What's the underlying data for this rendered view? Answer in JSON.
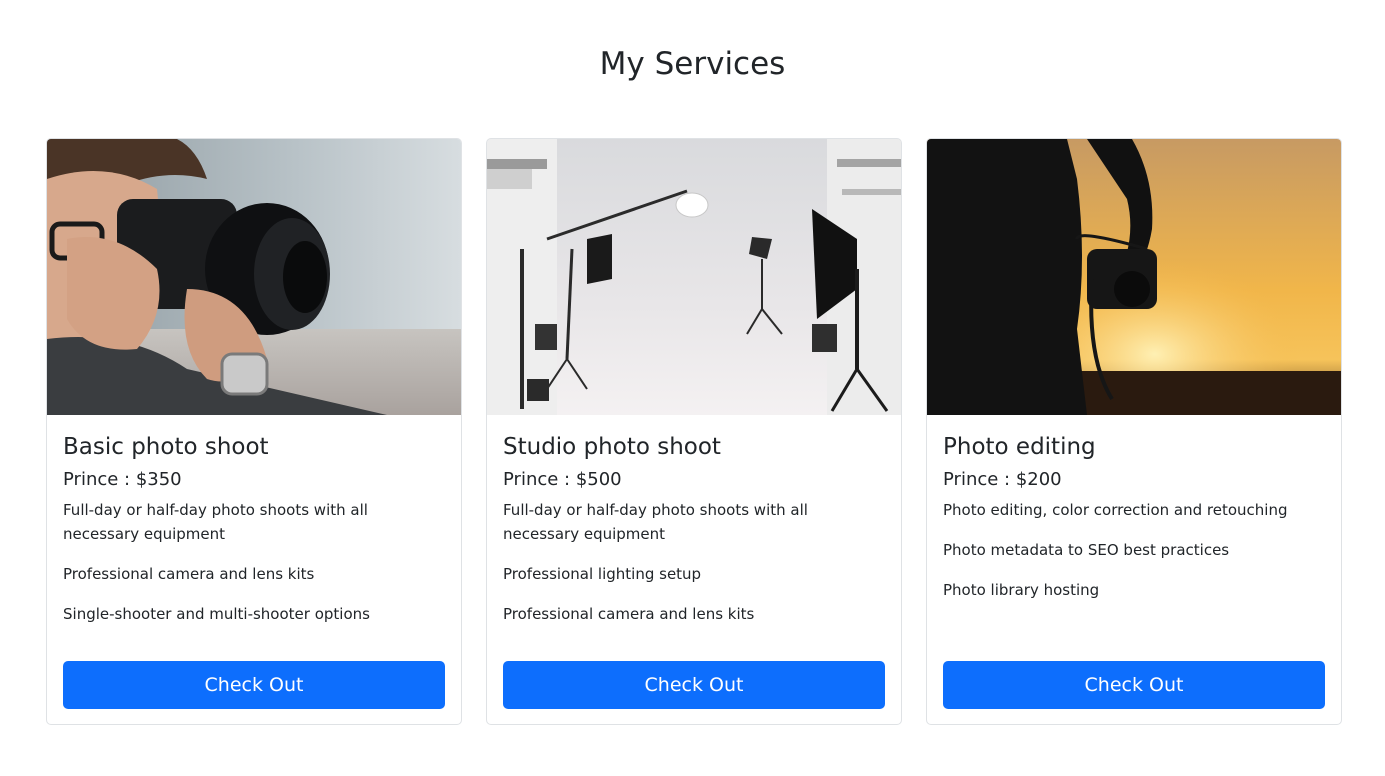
{
  "section": {
    "title": "My Services"
  },
  "accent_color": "#0d6efd",
  "cards": [
    {
      "image_alt": "photographer-with-camera",
      "title": "Basic photo shoot",
      "price": "Prince : $350",
      "features": [
        "Full-day or half-day photo shoots with all necessary equipment",
        "Professional camera and lens kits",
        "Single-shooter and multi-shooter options"
      ],
      "button_label": "Check Out"
    },
    {
      "image_alt": "photo-studio-lighting",
      "title": "Studio photo shoot",
      "price": "Prince : $500",
      "features": [
        "Full-day or half-day photo shoots with all necessary equipment",
        "Professional lighting setup",
        "Professional camera and lens kits"
      ],
      "button_label": "Check Out"
    },
    {
      "image_alt": "camera-silhouette-sunset",
      "title": "Photo editing",
      "price": "Prince : $200",
      "features": [
        "Photo editing, color correction and retouching",
        "Photo metadata to SEO best practices",
        "Photo library hosting"
      ],
      "button_label": "Check Out"
    }
  ]
}
